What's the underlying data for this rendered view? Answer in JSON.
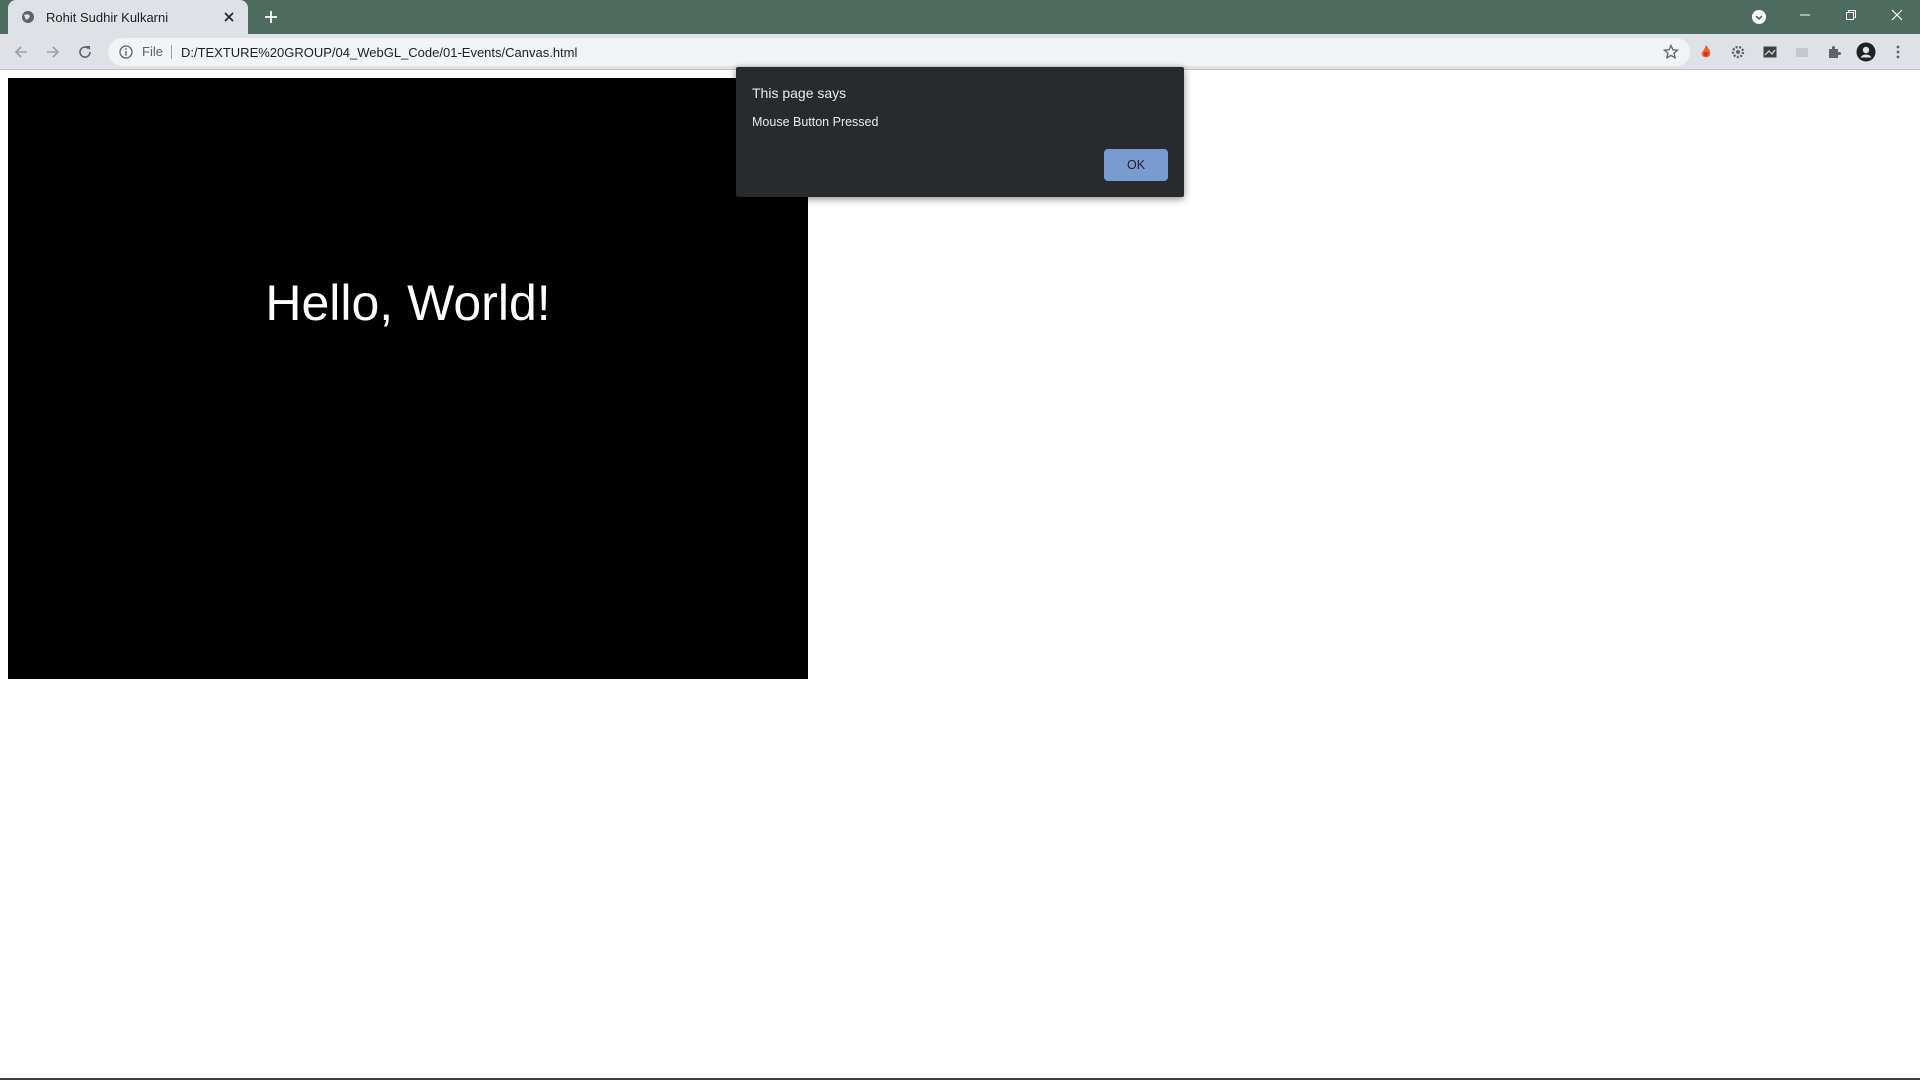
{
  "browser": {
    "tab": {
      "title": "Rohit Sudhir Kulkarni",
      "favicon": "globe-icon"
    },
    "address_bar": {
      "scheme_label": "File",
      "url": "D:/TEXTURE%20GROUP/04_WebGL_Code/01-Events/Canvas.html"
    },
    "extensions": [
      "fire-extension-icon",
      "gear-extension-icon",
      "image-extension-icon",
      "disabled-extension-icon",
      "puzzle-icon"
    ],
    "colors": {
      "titlebar": "#4d6b5e",
      "toolbar": "#dee1e6"
    }
  },
  "page": {
    "canvas_text": "Hello, World!",
    "canvas_bg": "#000000"
  },
  "dialog": {
    "title": "This page says",
    "message": "Mouse Button Pressed",
    "ok_label": "OK"
  }
}
